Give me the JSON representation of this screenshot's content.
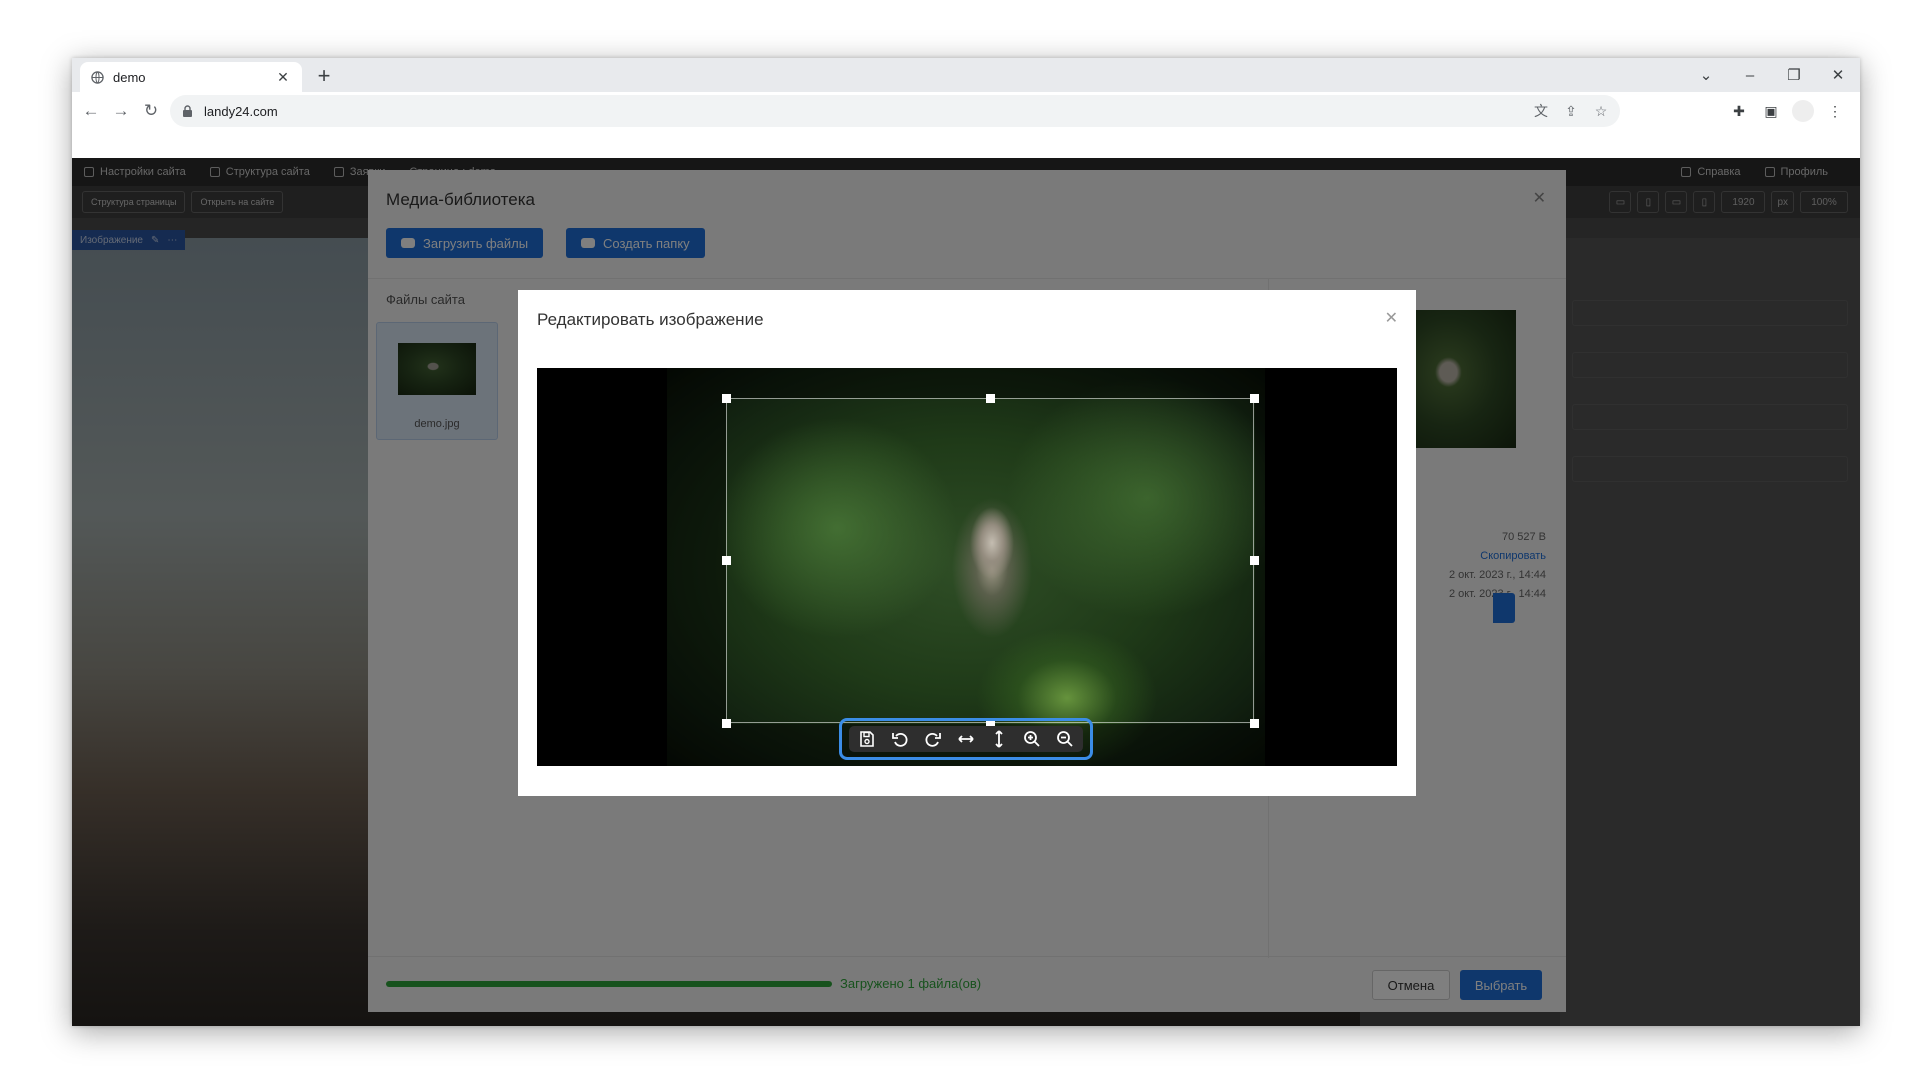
{
  "browser": {
    "tab_title": "demo",
    "url": "landy24.com"
  },
  "app": {
    "topbar_items": [
      "Настройки сайта",
      "Структура сайта",
      "Заявки",
      "Страница : demo"
    ],
    "help_label": "Справка",
    "profile_label": "Профиль",
    "toolbar_buttons": [
      "Структура страницы",
      "Открыть на сайте"
    ],
    "viewport_width": "1920",
    "viewport_unit": "px",
    "zoom": "100%",
    "selected_element": "Изображение"
  },
  "media_library": {
    "title": "Медиа-библиотека",
    "upload_button": "Загрузить файлы",
    "create_folder_button": "Создать папку",
    "files_label": "Файлы сайта",
    "file_name": "demo.jpg",
    "meta": {
      "size": "70 527 B",
      "copy_link": "Скопировать",
      "created": "2 окт. 2023 г., 14:44",
      "modified": "2 окт. 2023 г., 14:44"
    },
    "progress": 1.0,
    "progress_text": "Загружено 1 файла(ов)",
    "cancel_button": "Отмена",
    "select_button": "Выбрать"
  },
  "edit_dialog": {
    "title": "Редактировать изображение",
    "tools": [
      "save-icon",
      "rotate-left-icon",
      "rotate-right-icon",
      "flip-horizontal-icon",
      "flip-vertical-icon",
      "zoom-in-icon",
      "zoom-out-icon"
    ]
  },
  "colors": {
    "accent": "#1e6fd9",
    "success": "#2fa43a",
    "highlight": "#3b8de6"
  }
}
